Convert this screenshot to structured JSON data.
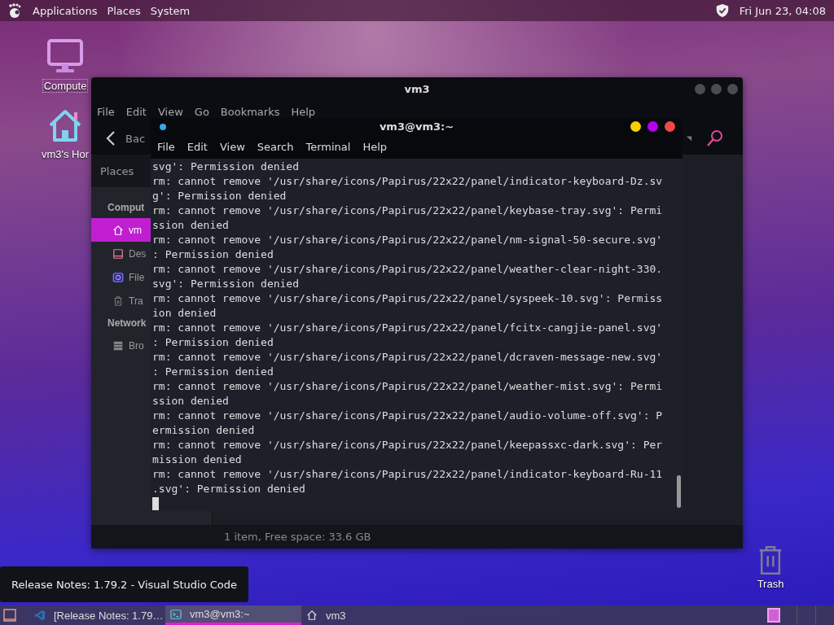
{
  "top_panel": {
    "menus": [
      "Applications",
      "Places",
      "System"
    ],
    "clock": "Fri Jun 23, 04:08"
  },
  "desktop_icons": [
    {
      "kind": "computer",
      "label": "Compute"
    },
    {
      "kind": "home",
      "label": "vm3's Hor"
    }
  ],
  "trash_icon": {
    "kind": "trash",
    "label": "Trash"
  },
  "file_manager": {
    "title": "vm3",
    "menu": [
      "File",
      "Edit",
      "View",
      "Go",
      "Bookmarks",
      "Help"
    ],
    "back_label": "Bac",
    "places_label": "Places",
    "sidebar": [
      {
        "kind": "heading",
        "label": "Comput"
      },
      {
        "kind": "home",
        "label": "vm",
        "selected": true
      },
      {
        "kind": "desktop",
        "label": "Des",
        "selected": false
      },
      {
        "kind": "files",
        "label": "File",
        "selected": false
      },
      {
        "kind": "trash",
        "label": "Tra",
        "selected": false
      },
      {
        "kind": "heading",
        "label": "Network"
      },
      {
        "kind": "network",
        "label": "Bro",
        "selected": false
      }
    ],
    "status": "1 item, Free space: 33.6 GB"
  },
  "terminal": {
    "title": "vm3@vm3:~",
    "menu": [
      "File",
      "Edit",
      "View",
      "Search",
      "Terminal",
      "Help"
    ],
    "lines": [
      "svg': Permission denied",
      "rm: cannot remove '/usr/share/icons/Papirus/22x22/panel/indicator-keyboard-Dz.sv",
      "g': Permission denied",
      "rm: cannot remove '/usr/share/icons/Papirus/22x22/panel/keybase-tray.svg': Permi",
      "ssion denied",
      "rm: cannot remove '/usr/share/icons/Papirus/22x22/panel/nm-signal-50-secure.svg'",
      ": Permission denied",
      "rm: cannot remove '/usr/share/icons/Papirus/22x22/panel/weather-clear-night-330.",
      "svg': Permission denied",
      "rm: cannot remove '/usr/share/icons/Papirus/22x22/panel/syspeek-10.svg': Permiss",
      "ion denied",
      "rm: cannot remove '/usr/share/icons/Papirus/22x22/panel/fcitx-cangjie-panel.svg'",
      ": Permission denied",
      "rm: cannot remove '/usr/share/icons/Papirus/22x22/panel/dcraven-message-new.svg'",
      ": Permission denied",
      "rm: cannot remove '/usr/share/icons/Papirus/22x22/panel/weather-mist.svg': Permi",
      "ssion denied",
      "rm: cannot remove '/usr/share/icons/Papirus/22x22/panel/audio-volume-off.svg': P",
      "ermission denied",
      "rm: cannot remove '/usr/share/icons/Papirus/22x22/panel/keepassxc-dark.svg': Per",
      "mission denied",
      "rm: cannot remove '/usr/share/icons/Papirus/22x22/panel/indicator-keyboard-Ru-11",
      ".svg': Permission denied"
    ]
  },
  "tooltip": "Release Notes: 1.79.2 - Visual Studio Code",
  "taskbar": {
    "tasks": [
      {
        "kind": "code",
        "label": "[Release Notes: 1.79…",
        "selected": false
      },
      {
        "kind": "terminal",
        "label": "vm3@vm3:~",
        "selected": true
      },
      {
        "kind": "home",
        "label": "vm3",
        "selected": false
      }
    ]
  }
}
